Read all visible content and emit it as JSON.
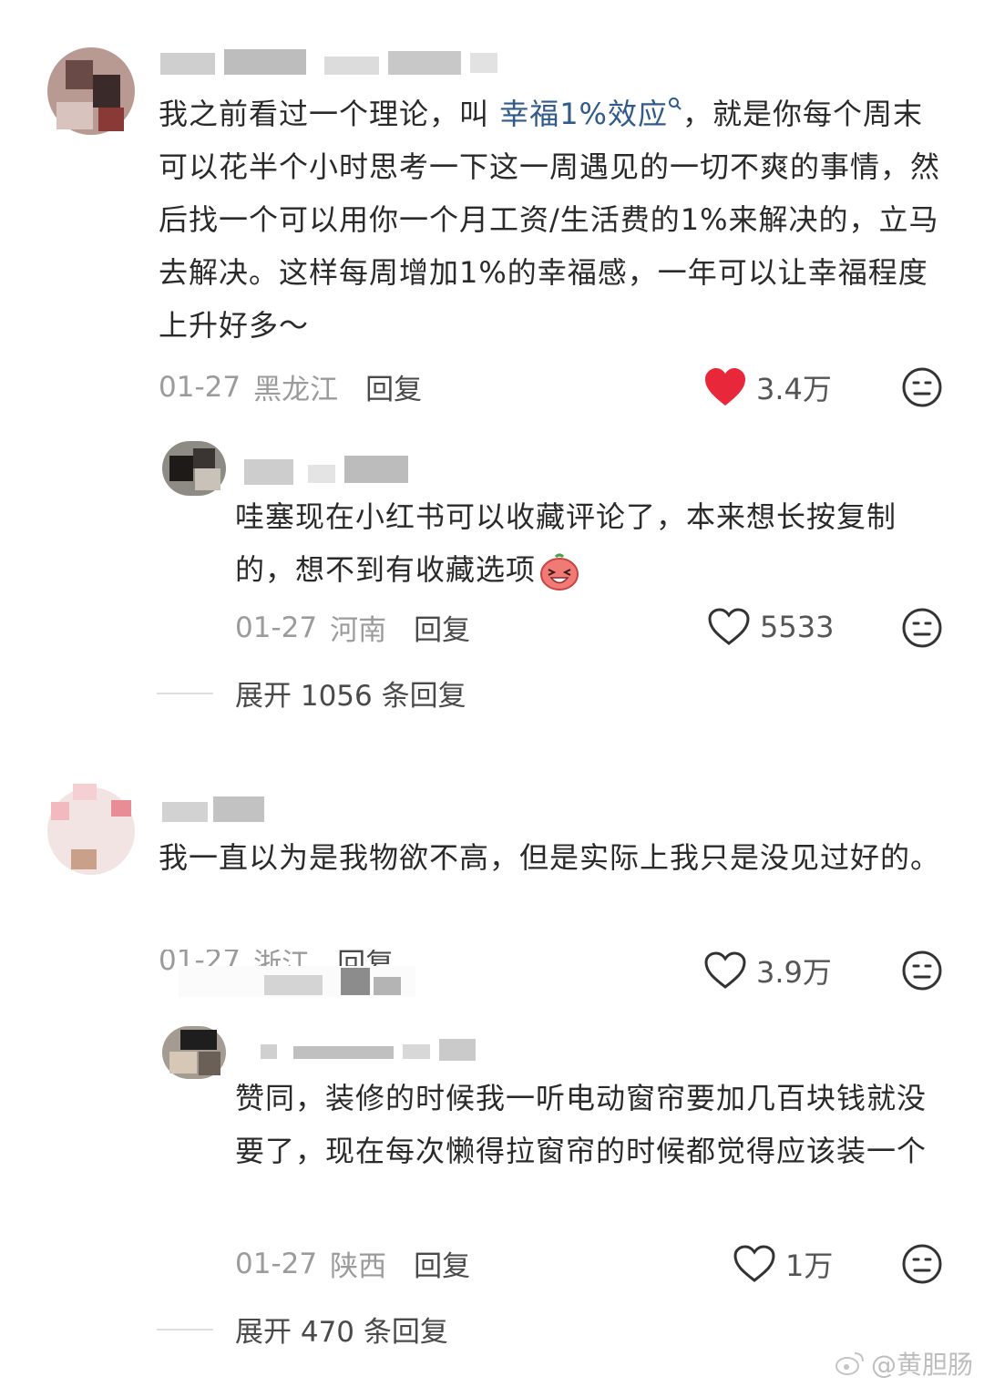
{
  "comments": [
    {
      "text_before": "我之前看过一个理论，叫 ",
      "link": "幸福1%效应",
      "text_after": "，就是你每个周末可以花半个小时思考一下这一周遇见的一切不爽的事情，然后找一个可以用你一个月工资/生活费的1%来解决的，立马去解决。这样每周增加1%的幸福感，一年可以让幸福程度上升好多～",
      "date": "01-27",
      "location": "黑龙江",
      "reply_label": "回复",
      "likes": "3.4万",
      "liked": true,
      "replies": [
        {
          "text": "哇塞现在小红书可以收藏评论了，本来想长按复制的，想不到有收藏选项",
          "date": "01-27",
          "location": "河南",
          "reply_label": "回复",
          "likes": "5533"
        }
      ],
      "expand_label": "展开 1056 条回复"
    },
    {
      "text": "我一直以为是我物欲不高，但是实际上我只是没见过好的。",
      "date": "01-27",
      "location": "浙江",
      "reply_label": "回复",
      "likes": "3.9万",
      "liked": false,
      "replies": [
        {
          "text": "赞同，装修的时候我一听电动窗帘要加几百块钱就没要了，现在每次懒得拉窗帘的时候都觉得应该装一个",
          "date": "01-27",
          "location": "陕西",
          "reply_label": "回复",
          "likes": "1万"
        }
      ],
      "expand_label": "展开 470 条回复"
    }
  ],
  "watermark": "@黄胆肠",
  "colors": {
    "liked_heart": "#e8283a",
    "link": "#2f5a8a",
    "meta": "#9b9b9b"
  }
}
